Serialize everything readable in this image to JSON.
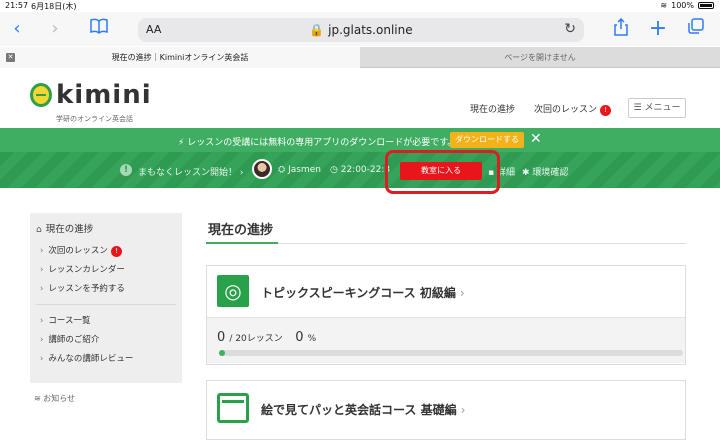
{
  "statusbar": {
    "time": "21:57",
    "date": "6月18日(木)",
    "battery": "100%"
  },
  "browser": {
    "aa_label": "AA",
    "url": "jp.glats.online",
    "tabs": [
      {
        "label": "現在の進捗｜Kiminiオンライン英会話"
      },
      {
        "label": "ページを開けません"
      }
    ]
  },
  "site": {
    "logo_text": "kimini",
    "logo_sub": "学研のオンライン英会話",
    "nav": {
      "progress": "現在の進捗",
      "next_lesson": "次回のレッスン",
      "next_lesson_badge": "!",
      "menu": "メニュー"
    }
  },
  "download_banner": {
    "message": "レッスンの受講には無料の専用アプリのダウンロードが必要です。",
    "button": "ダウンロードする"
  },
  "lesson_bar": {
    "notice": "まもなくレッスン開始！",
    "teacher": "Jasmen",
    "time": "22:00-22:3",
    "enter_button": "教室に入る",
    "detail": "詳細",
    "env_check": "環境確認"
  },
  "sidebar": {
    "title": "現在の進捗",
    "items_group1": [
      {
        "label": "次回のレッスン",
        "badge": "!"
      },
      {
        "label": "レッスンカレンダー"
      },
      {
        "label": "レッスンを予約する"
      }
    ],
    "items_group2": [
      {
        "label": "コース一覧"
      },
      {
        "label": "講師のご紹介"
      },
      {
        "label": "みんなの講師レビュー"
      }
    ],
    "news": "お知らせ"
  },
  "main": {
    "title": "現在の進捗",
    "courses": [
      {
        "title": "トピックスピーキングコース 初級編",
        "done": "0",
        "total": "/ 20レッスン",
        "percent": "0",
        "percent_unit": "%",
        "progress_fraction": 0
      },
      {
        "title": "絵で見てパッと英会話コース 基礎編"
      }
    ]
  }
}
